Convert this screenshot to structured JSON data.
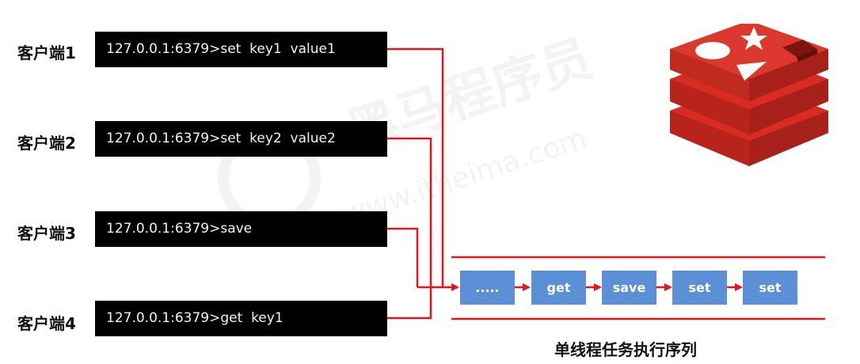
{
  "clients": [
    {
      "label": "客户端1",
      "command": "127.0.0.1:6379>set  key1  value1"
    },
    {
      "label": "客户端2",
      "command": "127.0.0.1:6379>set  key2  value2"
    },
    {
      "label": "客户端3",
      "command": "127.0.0.1:6379>save"
    },
    {
      "label": "客户端4",
      "command": "127.0.0.1:6379>get  key1"
    }
  ],
  "queue": {
    "items": [
      ".....",
      "get",
      "save",
      "set",
      "set"
    ],
    "caption": "单线程任务执行序列"
  },
  "watermark": {
    "brand": "黑马程序员",
    "trademark": "TM",
    "url": "www.itheima.com"
  },
  "colors": {
    "connector": "#e8141c",
    "queue_box": "#5b8fd6",
    "terminal_bg": "#000000",
    "logo_red": "#d82c20"
  },
  "icons": {
    "logo": "redis-logo-icon"
  }
}
